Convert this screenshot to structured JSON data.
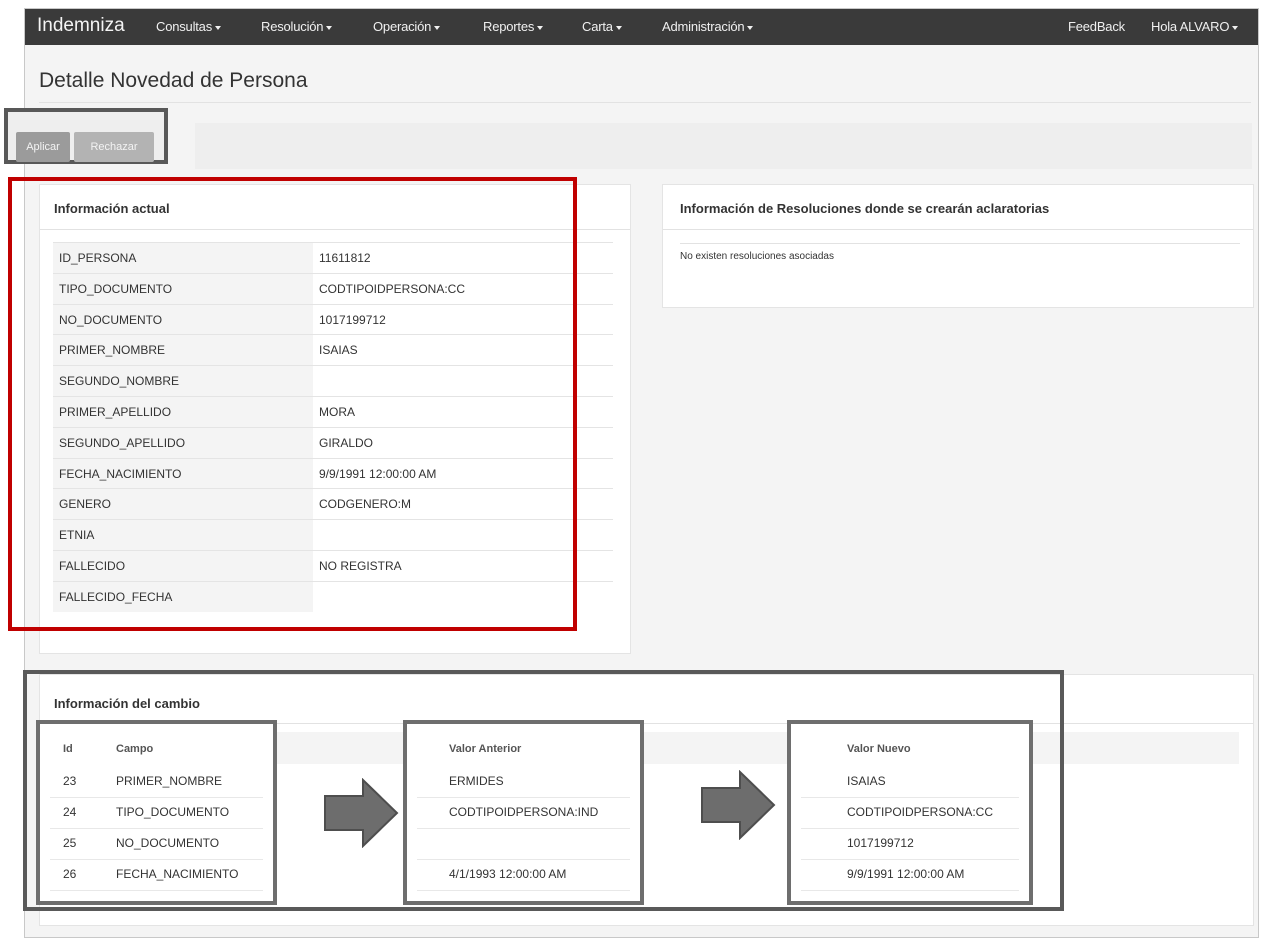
{
  "navbar": {
    "brand": "Indemniza",
    "menus": [
      "Consultas",
      "Resolución",
      "Operación",
      "Reportes",
      "Carta",
      "Administración"
    ],
    "feedback": "FeedBack",
    "user": "Hola ALVARO"
  },
  "page_title": "Detalle Novedad de Persona",
  "actions": {
    "apply": "Aplicar",
    "reject": "Rechazar"
  },
  "current_info": {
    "heading": "Información actual",
    "rows": [
      {
        "key": "ID_PERSONA",
        "value": "11611812"
      },
      {
        "key": "TIPO_DOCUMENTO",
        "value": "CODTIPOIDPERSONA:CC"
      },
      {
        "key": "NO_DOCUMENTO",
        "value": "1017199712"
      },
      {
        "key": "PRIMER_NOMBRE",
        "value": "ISAIAS"
      },
      {
        "key": "SEGUNDO_NOMBRE",
        "value": ""
      },
      {
        "key": "PRIMER_APELLIDO",
        "value": "MORA"
      },
      {
        "key": "SEGUNDO_APELLIDO",
        "value": "GIRALDO"
      },
      {
        "key": "FECHA_NACIMIENTO",
        "value": "9/9/1991 12:00:00 AM"
      },
      {
        "key": "GENERO",
        "value": "CODGENERO:M"
      },
      {
        "key": "ETNIA",
        "value": ""
      },
      {
        "key": "FALLECIDO",
        "value": "NO REGISTRA"
      },
      {
        "key": "FALLECIDO_FECHA",
        "value": ""
      }
    ]
  },
  "resolutions": {
    "heading": "Información de Resoluciones donde se crearán aclaratorias",
    "empty_text": "No existen resoluciones asociadas"
  },
  "change_info": {
    "heading": "Información del cambio",
    "columns": {
      "id": "Id",
      "field": "Campo",
      "old": "Valor Anterior",
      "new": "Valor Nuevo"
    },
    "rows": [
      {
        "id": "23",
        "field": "PRIMER_NOMBRE",
        "old": "ERMIDES",
        "new": "ISAIAS"
      },
      {
        "id": "24",
        "field": "TIPO_DOCUMENTO",
        "old": "CODTIPOIDPERSONA:IND",
        "new": "CODTIPOIDPERSONA:CC"
      },
      {
        "id": "25",
        "field": "NO_DOCUMENTO",
        "old": "",
        "new": "1017199712"
      },
      {
        "id": "26",
        "field": "FECHA_NACIMIENTO",
        "old": "4/1/1993 12:00:00 AM",
        "new": "9/9/1991 12:00:00 AM"
      }
    ]
  },
  "colors": {
    "navbar": "#3a3a3a",
    "highlight_red": "#c00000",
    "annotation_gray": "#595959"
  }
}
